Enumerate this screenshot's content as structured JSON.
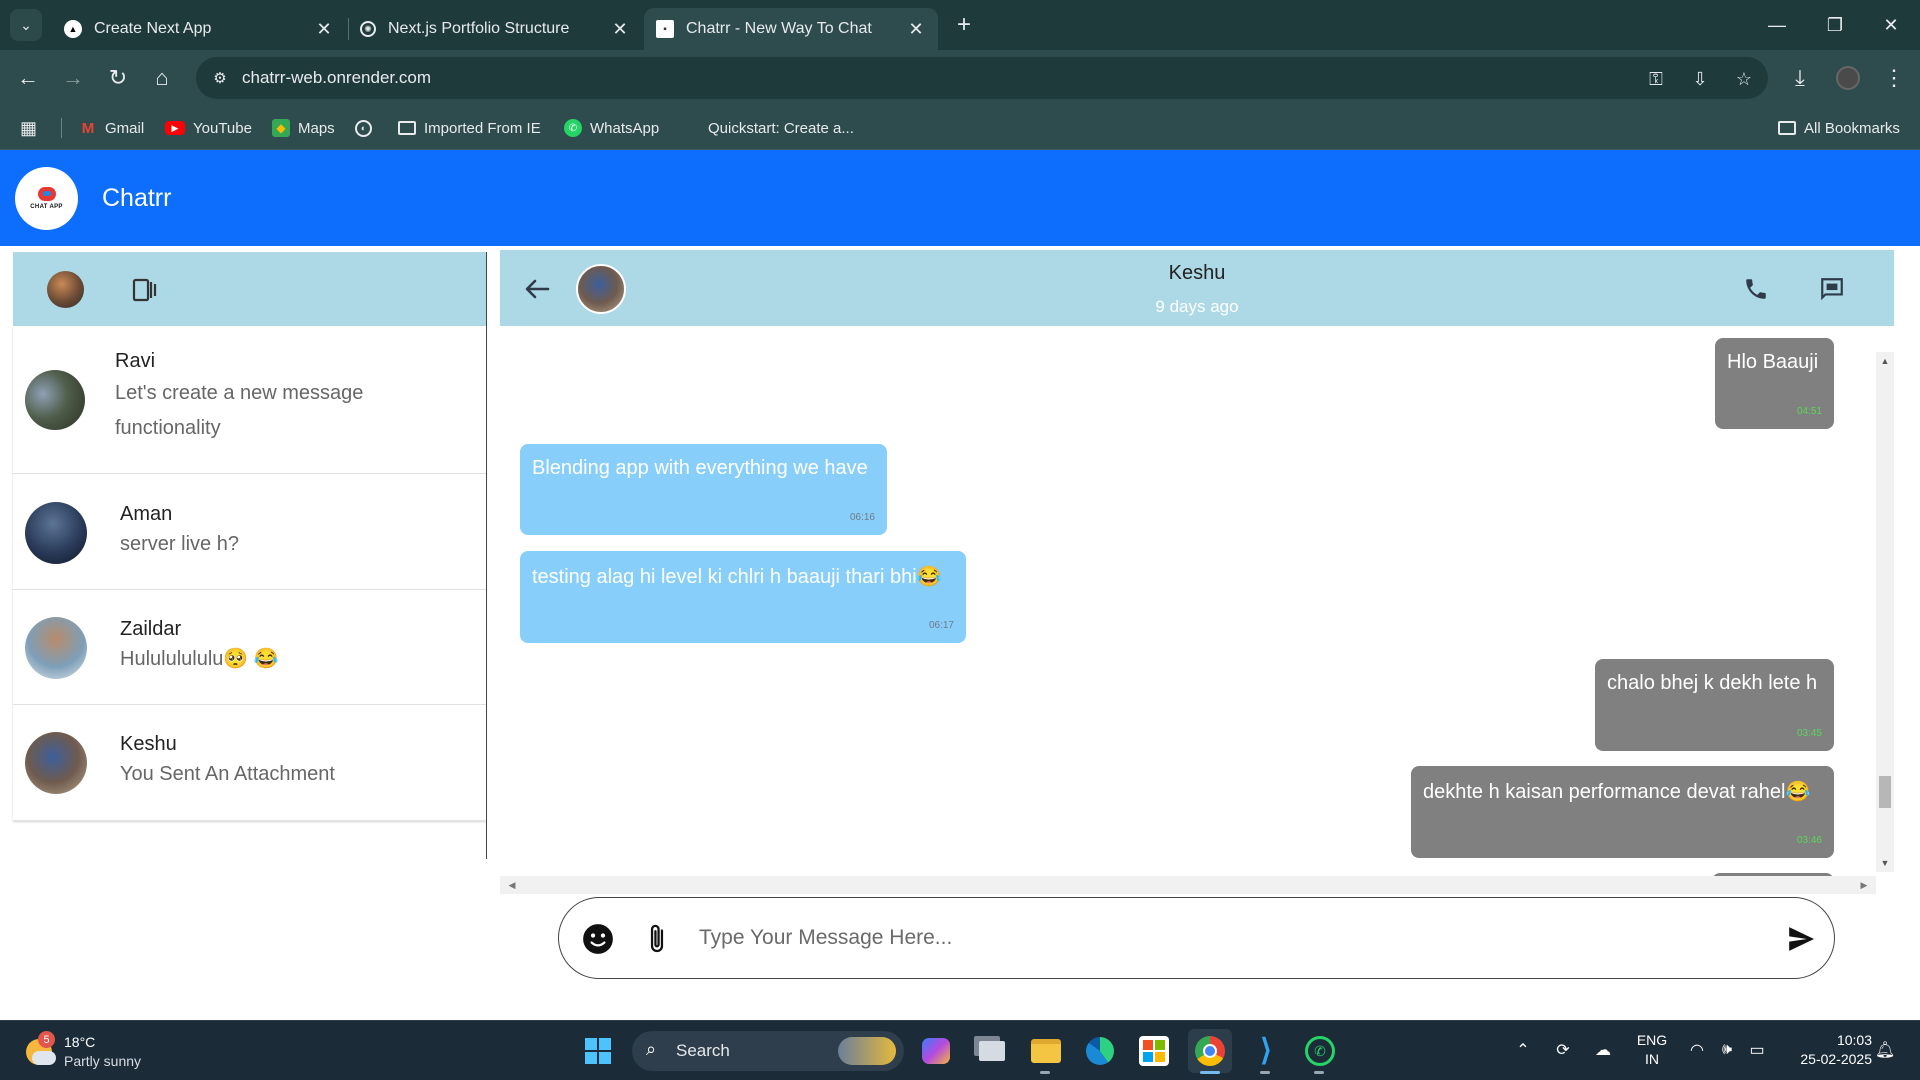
{
  "browser": {
    "tabs": [
      {
        "title": "Create Next App",
        "icon": "next-triangle-icon",
        "active": false
      },
      {
        "title": "Next.js Portfolio Structure",
        "icon": "openai-icon",
        "active": false
      },
      {
        "title": "Chatrr - New Way To Chat",
        "icon": "page-icon",
        "active": true
      }
    ],
    "url": "chatrr-web.onrender.com",
    "bookmarks": [
      {
        "label": "Gmail",
        "icon": "gmail-icon"
      },
      {
        "label": "YouTube",
        "icon": "youtube-icon"
      },
      {
        "label": "Maps",
        "icon": "maps-icon"
      },
      {
        "label": "",
        "icon": "globe-icon"
      },
      {
        "label": "Imported From IE",
        "icon": "folder-icon"
      },
      {
        "label": "WhatsApp",
        "icon": "whatsapp-icon"
      },
      {
        "label": "Quickstart: Create a...",
        "icon": "microsoft-icon"
      }
    ],
    "all_bookmarks": "All Bookmarks"
  },
  "app": {
    "title": "Chatrr",
    "logo_text": "CHAT APP",
    "accent": "#0d6efd",
    "panel_color": "#add8e6"
  },
  "sidebar": {
    "chats": [
      {
        "name": "Ravi",
        "last_message": "Let's create a new message functionality"
      },
      {
        "name": "Aman",
        "last_message": "server live h?"
      },
      {
        "name": "Zaildar",
        "last_message": "Hulululululu🥺 😂"
      },
      {
        "name": "Keshu",
        "last_message": "You Sent An Attachment"
      }
    ]
  },
  "chat": {
    "contact_name": "Keshu",
    "status": "9 days ago",
    "messages": [
      {
        "direction": "out",
        "text": "Hlo Baauji",
        "time": "04:51"
      },
      {
        "direction": "in",
        "text": "Blending app with everything we have",
        "time": "06:16"
      },
      {
        "direction": "in",
        "text": "testing alag hi level ki chlri h baauji thari bhi😂",
        "time": "06:17"
      },
      {
        "direction": "out",
        "text": "chalo bhej k dekh lete h",
        "time": "03:45"
      },
      {
        "direction": "out",
        "text": "dekhte h kaisan performance devat rahel😂",
        "time": "03:46"
      }
    ]
  },
  "composer": {
    "placeholder": "Type Your Message Here..."
  },
  "taskbar": {
    "weather_badge": "5",
    "temperature": "18°C",
    "condition": "Partly sunny",
    "search_label": "Search",
    "lang_primary": "ENG",
    "lang_region": "IN",
    "time": "10:03",
    "date": "25-02-2025"
  }
}
